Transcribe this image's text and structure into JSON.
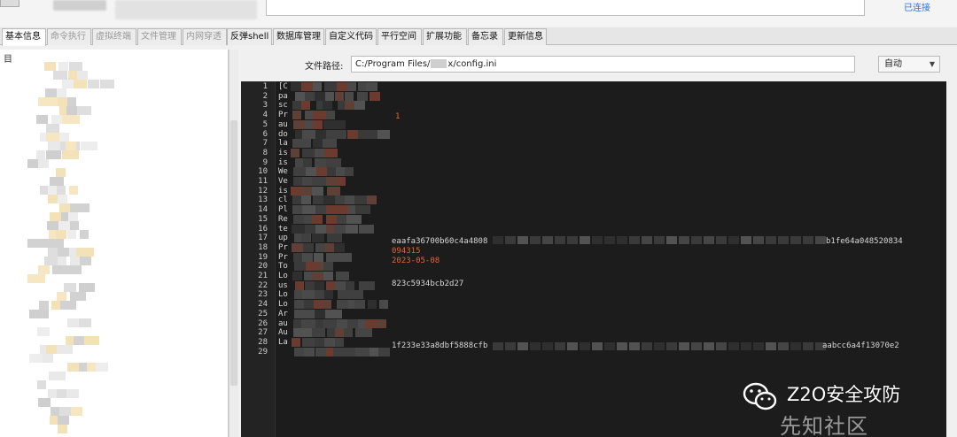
{
  "window": {
    "connection_status": "已连接"
  },
  "tabs": [
    {
      "label": "基本信息"
    },
    {
      "label": "命令执行"
    },
    {
      "label": "虚拟终端"
    },
    {
      "label": "文件管理"
    },
    {
      "label": "内网穿透"
    },
    {
      "label": "反弹shell"
    },
    {
      "label": "数据库管理"
    },
    {
      "label": "自定义代码"
    },
    {
      "label": "平行空间"
    },
    {
      "label": "扩展功能"
    },
    {
      "label": "备忘录"
    },
    {
      "label": "更新信息"
    }
  ],
  "tree": {
    "header": "目"
  },
  "file_editor": {
    "path_label": "文件路径:",
    "path_prefix": "C:/Program Files/",
    "path_suffix": "x/config.ini",
    "encoding": "自动",
    "line_numbers": [
      "1",
      "2",
      "3",
      "4",
      "5",
      "6",
      "7",
      "8",
      "9",
      "10",
      "11",
      "12",
      "13",
      "14",
      "15",
      "16",
      "17",
      "18",
      "19",
      "20",
      "21",
      "22",
      "23",
      "24",
      "25",
      "26",
      "27",
      "28",
      "29"
    ],
    "line_prefixes": [
      "[C",
      "pa",
      "sc",
      "Pr",
      "au",
      "do",
      "la",
      "is",
      "is",
      "We",
      "Ve",
      "is",
      "cl",
      "Pl",
      "Re",
      "te",
      "up",
      "Pr",
      "Pr",
      "To",
      "Lo",
      "us",
      "Lo",
      "Lo",
      "Ar",
      "au",
      "Au",
      "La",
      ""
    ],
    "visible_values": {
      "line4": "1",
      "line16": "eaafa36700b60c4a4808",
      "line16_tail": "b1fe64a048520834",
      "line17": "094315",
      "line18": "2023-05-08",
      "line20": "823c5934bcb2d27",
      "line26": "1f233e33a8dbf5888cfb",
      "line26_tail": "aabcc6a4f13070e2"
    }
  },
  "watermark": {
    "brand": "Z2O安全攻防",
    "site": "先知社区"
  }
}
